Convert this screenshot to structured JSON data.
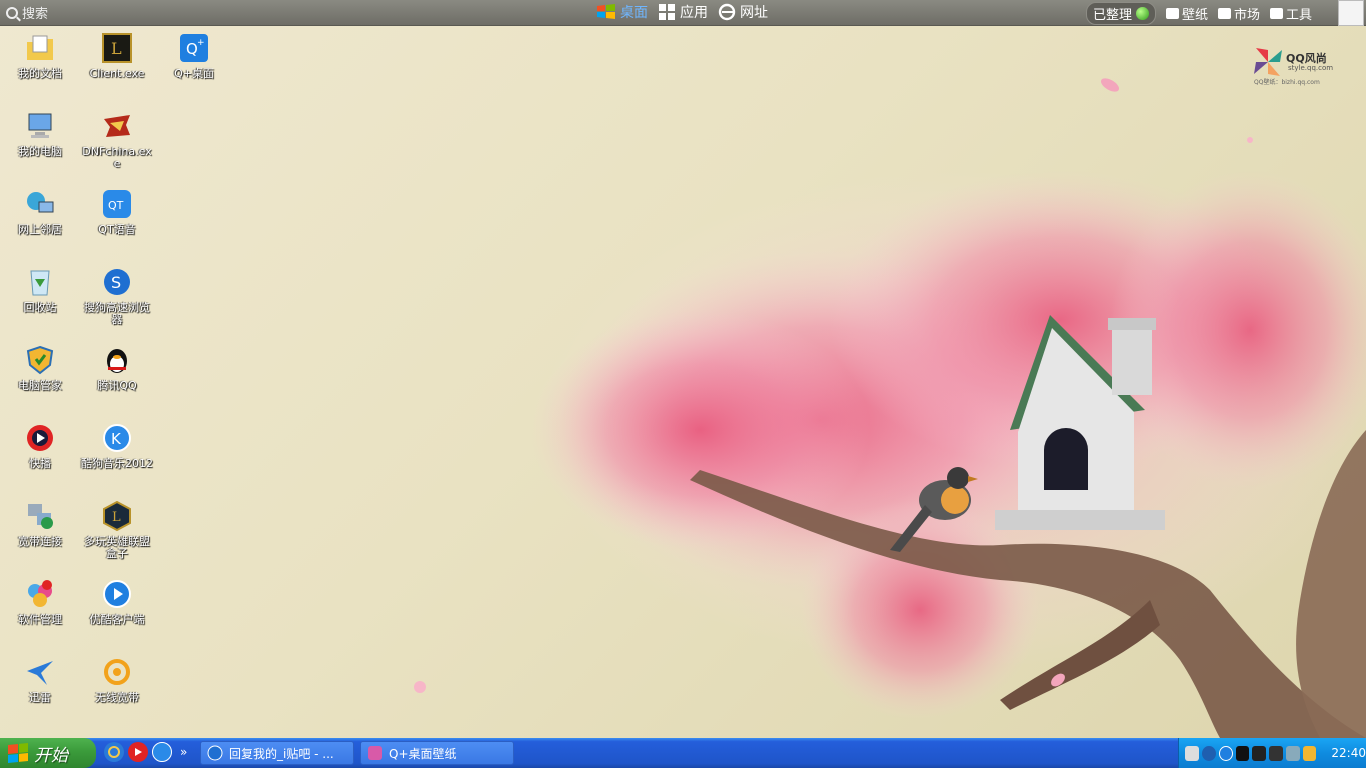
{
  "topbar": {
    "search_label": "搜索",
    "tabs": [
      {
        "label": "桌面",
        "icon": "windows-icon",
        "active": true
      },
      {
        "label": "应用",
        "icon": "grid-icon",
        "active": false
      },
      {
        "label": "网址",
        "icon": "ie-icon",
        "active": false
      }
    ],
    "organized_label": "已整理",
    "tools": [
      {
        "label": "壁纸",
        "icon": "shirt-icon"
      },
      {
        "label": "市场",
        "icon": "bag-icon"
      },
      {
        "label": "工具",
        "icon": "toolbox-icon"
      }
    ]
  },
  "logo": {
    "title": "QQ风尚",
    "url": "style.qq.com",
    "sub": "QQ壁纸：bizhi.qq.com"
  },
  "desktop": {
    "col1": [
      {
        "label": "我的文档",
        "icon": "documents-folder-icon"
      },
      {
        "label": "我的电脑",
        "icon": "computer-icon"
      },
      {
        "label": "网上邻居",
        "icon": "network-icon"
      },
      {
        "label": "回收站",
        "icon": "recycle-bin-icon"
      },
      {
        "label": "电脑管家",
        "icon": "shield-icon"
      },
      {
        "label": "快播",
        "icon": "qvod-play-icon"
      },
      {
        "label": "宽带连接",
        "icon": "broadband-icon"
      },
      {
        "label": "软件管理",
        "icon": "software-manager-icon"
      },
      {
        "label": "迅雷",
        "icon": "thunder-bird-icon"
      }
    ],
    "col2": [
      {
        "label": "Client.exe",
        "icon": "lol-client-icon"
      },
      {
        "label": "DNFchina.exe",
        "icon": "dnf-icon"
      },
      {
        "label": "QT语音",
        "icon": "qt-voice-icon"
      },
      {
        "label": "搜狗高速浏览器",
        "icon": "sogou-browser-icon"
      },
      {
        "label": "腾讯QQ",
        "icon": "qq-penguin-icon"
      },
      {
        "label": "酷狗音乐2012",
        "icon": "kugou-icon"
      },
      {
        "label": "多玩英雄联盟盒子",
        "icon": "lol-box-icon"
      },
      {
        "label": "优酷客户端",
        "icon": "youku-icon"
      },
      {
        "label": "无线宽带",
        "icon": "wireless-icon"
      }
    ],
    "col3": [
      {
        "label": "Q+桌面",
        "icon": "qplus-icon"
      }
    ]
  },
  "taskbar": {
    "start_label": "开始",
    "tasks": [
      {
        "label": "回复我的_i贴吧 - ...",
        "icon": "sogou-browser-icon"
      },
      {
        "label": "Q+桌面壁纸",
        "icon": "qplus-wallpaper-icon"
      }
    ],
    "clock": "22:40"
  },
  "colors": {
    "taskbar": "#245edb",
    "start": "#3b9b3b",
    "tray": "#0f8ce0",
    "accent_tab": "#6fb6ff"
  }
}
